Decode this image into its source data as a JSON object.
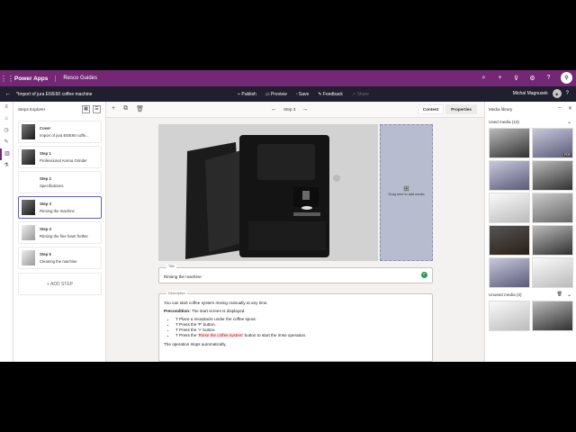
{
  "topbar": {
    "app_name": "Power Apps",
    "env_name": "Resco Guides",
    "avatar_initials": ""
  },
  "cmdbar": {
    "title": "*Import of jura E6/E60 coffee machine",
    "publish": "Publish",
    "preview": "Preview",
    "save": "Save",
    "feedback": "Feedback",
    "share": "Share",
    "user_name": "Michal Magnusek"
  },
  "steps_panel": {
    "title": "Steps Explorer",
    "items": [
      {
        "title": "Cover",
        "subtitle": "Import of jura E6/E60 coffe..."
      },
      {
        "title": "Step 1",
        "subtitle": "Professional Aroma Grinder"
      },
      {
        "title": "Step 2",
        "subtitle": "Specifications"
      },
      {
        "title": "Step 3",
        "subtitle": "Rinsing the machine"
      },
      {
        "title": "Step 4",
        "subtitle": "Rinsing the fine foam frother"
      },
      {
        "title": "Step 5",
        "subtitle": "Cleaning the machine"
      }
    ],
    "add_step": "+ ADD STEP"
  },
  "editor": {
    "step_label": "Step 3",
    "tab_content": "Content",
    "tab_properties": "Properties",
    "dropzone_text": "Drag here to add media",
    "title_label": "Title",
    "title_value": "Rinsing the machine",
    "desc_label": "Description",
    "desc_intro": "You can start coffee system rinsing manually at any time.",
    "precondition_label": "Precondition:",
    "precondition_text": " The start screen is displayed.",
    "bullets": [
      "T Place a receptacle under the coffee spout.",
      "T Press the 'P' button.",
      "T Press the '>' button."
    ],
    "bullet4_a": "T Press the '",
    "bullet4_hl": "Rinse the coffee system",
    "bullet4_b": "' button to start the rinse operation.",
    "desc_outro": "The operation stops automatically."
  },
  "media_panel": {
    "title": "Media library",
    "used_label": "Used media (10)",
    "unused_label": "Unused media (3)",
    "pdf_badge": "PDF"
  },
  "colors": {
    "brand": "#742774",
    "cmdbar": "#1f1f2e",
    "accent": "#5b5fc7",
    "dropzone": "#b7bccf"
  }
}
